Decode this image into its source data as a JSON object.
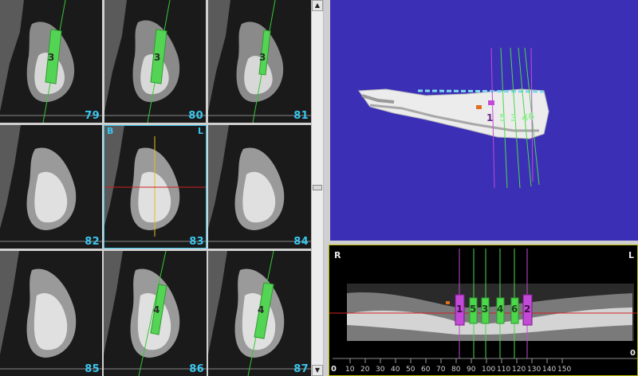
{
  "colors": {
    "slice_number": "#39c6ee",
    "implant_green": "#4bd84b",
    "implant_magenta": "#c24ad6",
    "view3d_bg": "#3b2fb5",
    "crosshair_red": "#d02020",
    "crosshair_yellow": "#e0c020"
  },
  "cross_sections": [
    {
      "slice": "79",
      "implant": "3"
    },
    {
      "slice": "80",
      "implant": "3"
    },
    {
      "slice": "81",
      "implant": "3"
    },
    {
      "slice": "82"
    },
    {
      "slice": "83",
      "selected": true,
      "left_corner": "B",
      "right_corner": "L"
    },
    {
      "slice": "84"
    },
    {
      "slice": "85"
    },
    {
      "slice": "86",
      "implant": "4"
    },
    {
      "slice": "87",
      "implant": "4"
    }
  ],
  "view3d": {
    "implant_labels": [
      "1",
      "5",
      "3",
      "4",
      "6"
    ]
  },
  "panoramic": {
    "left_corner": "R",
    "right_corner": "L",
    "implants": [
      "1",
      "5",
      "3",
      "4",
      "6",
      "2"
    ],
    "ruler_ticks": [
      "10",
      "20",
      "30",
      "40",
      "50",
      "60",
      "70",
      "80",
      "90",
      "100",
      "110",
      "120",
      "130",
      "140",
      "150"
    ],
    "ruler_left": "0",
    "ruler_right": "0"
  },
  "scrollbar": {
    "up_icon": "▲",
    "down_icon": "▼"
  }
}
